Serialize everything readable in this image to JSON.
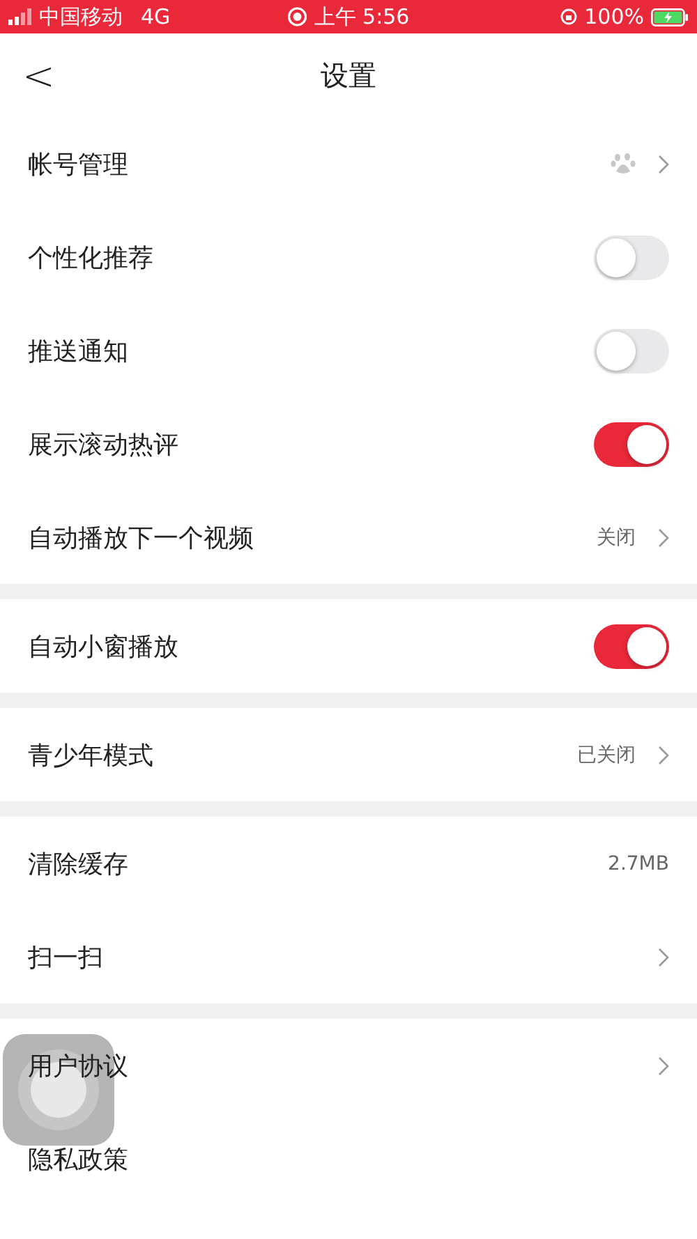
{
  "status_bar": {
    "carrier": "中国移动",
    "network": "4G",
    "time": "上午 5:56",
    "battery": "100%"
  },
  "header": {
    "back": "<",
    "title": "设置"
  },
  "groups": [
    {
      "items": [
        {
          "kind": "account",
          "label": "帐号管理"
        },
        {
          "kind": "toggle",
          "label": "个性化推荐",
          "on": false
        },
        {
          "kind": "toggle",
          "label": "推送通知",
          "on": false
        },
        {
          "kind": "toggle",
          "label": "展示滚动热评",
          "on": true
        },
        {
          "kind": "link",
          "label": "自动播放下一个视频",
          "value": "关闭"
        }
      ]
    },
    {
      "items": [
        {
          "kind": "toggle",
          "label": "自动小窗播放",
          "on": true
        }
      ]
    },
    {
      "items": [
        {
          "kind": "link",
          "label": "青少年模式",
          "value": "已关闭"
        }
      ]
    },
    {
      "items": [
        {
          "kind": "info",
          "label": "清除缓存",
          "value": "2.7MB"
        },
        {
          "kind": "link",
          "label": "扫一扫"
        }
      ]
    },
    {
      "items": [
        {
          "kind": "link",
          "label": "用户协议"
        },
        {
          "kind": "plain",
          "label": "隐私政策"
        },
        {
          "kind": "cut"
        }
      ]
    }
  ]
}
